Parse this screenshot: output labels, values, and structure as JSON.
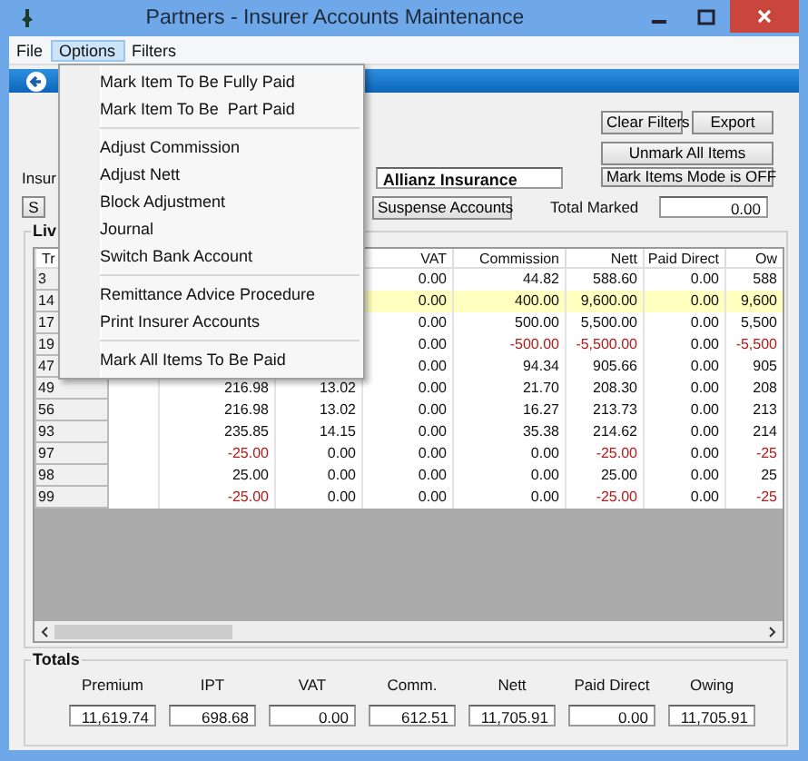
{
  "window": {
    "title": "Partners - Insurer Accounts Maintenance"
  },
  "menubar": [
    {
      "label": "File",
      "selected": false
    },
    {
      "label": "Options",
      "selected": true
    },
    {
      "label": "Filters",
      "selected": false
    }
  ],
  "options_menu": [
    [
      "Mark Item To Be Fully Paid",
      "Mark Item To Be  Part Paid"
    ],
    [
      "Adjust Commission",
      "Adjust Nett",
      "Block Adjustment",
      "Journal",
      "Switch Bank Account"
    ],
    [
      "Remittance Advice Procedure",
      "Print Insurer Accounts"
    ],
    [
      "Mark All Items To Be Paid"
    ]
  ],
  "form": {
    "clear_filters": "Clear Filters",
    "export": "Export",
    "unmark_all": "Unmark All Items",
    "mark_mode": "Mark Items Mode is OFF",
    "insurer_label": "Insur",
    "insurer_value": "Allianz Insurance",
    "s_button": "S",
    "suspense": "Suspense Accounts",
    "total_marked_label": "Total Marked",
    "total_marked_value": "0.00"
  },
  "table": {
    "group_label": "Liv",
    "columns": [
      "Tr",
      null,
      null,
      null,
      "VAT",
      "Commission",
      "Nett",
      "Paid Direct",
      "Ow"
    ],
    "rows": [
      {
        "selected": false,
        "cells": [
          "3",
          null,
          null,
          null,
          "0.00",
          "44.82",
          "588.60",
          "0.00",
          "588"
        ]
      },
      {
        "selected": true,
        "cells": [
          "14",
          null,
          null,
          null,
          "0.00",
          "400.00",
          "9,600.00",
          "0.00",
          "9,600"
        ]
      },
      {
        "selected": false,
        "cells": [
          "17",
          null,
          null,
          null,
          "0.00",
          "500.00",
          "5,500.00",
          "0.00",
          "5,500"
        ]
      },
      {
        "selected": false,
        "cells": [
          "19",
          null,
          null,
          null,
          "0.00",
          {
            "text": "-500.00",
            "negative": true
          },
          {
            "text": "-5,500.00",
            "negative": true
          },
          "0.00",
          {
            "text": "-5,500",
            "negative": true
          }
        ]
      },
      {
        "selected": false,
        "cells": [
          "47",
          null,
          null,
          null,
          "0.00",
          "94.34",
          "905.66",
          "0.00",
          "905"
        ]
      },
      {
        "selected": false,
        "cells": [
          "49",
          null,
          "216.98",
          "13.02",
          "0.00",
          "21.70",
          "208.30",
          "0.00",
          "208"
        ]
      },
      {
        "selected": false,
        "cells": [
          "56",
          null,
          "216.98",
          "13.02",
          "0.00",
          "16.27",
          "213.73",
          "0.00",
          "213"
        ]
      },
      {
        "selected": false,
        "cells": [
          "93",
          null,
          "235.85",
          "14.15",
          "0.00",
          "35.38",
          "214.62",
          "0.00",
          "214"
        ]
      },
      {
        "selected": false,
        "cells": [
          "97",
          null,
          {
            "text": "-25.00",
            "negative": true
          },
          "0.00",
          "0.00",
          "0.00",
          {
            "text": "-25.00",
            "negative": true
          },
          "0.00",
          {
            "text": "-25",
            "negative": true
          }
        ]
      },
      {
        "selected": false,
        "cells": [
          "98",
          null,
          "25.00",
          "0.00",
          "0.00",
          "0.00",
          "25.00",
          "0.00",
          "25"
        ]
      },
      {
        "selected": false,
        "cells": [
          "99",
          null,
          {
            "text": "-25.00",
            "negative": true
          },
          "0.00",
          "0.00",
          "0.00",
          {
            "text": "-25.00",
            "negative": true
          },
          "0.00",
          {
            "text": "-25",
            "negative": true
          }
        ]
      }
    ]
  },
  "totals": {
    "label": "Totals",
    "items": [
      {
        "label": "Premium",
        "value": "11,619.74"
      },
      {
        "label": "IPT",
        "value": "698.68"
      },
      {
        "label": "VAT",
        "value": "0.00"
      },
      {
        "label": "Comm.",
        "value": "612.51"
      },
      {
        "label": "Nett",
        "value": "11,705.91"
      },
      {
        "label": "Paid Direct",
        "value": "0.00"
      },
      {
        "label": "Owing",
        "value": "11,705.91"
      }
    ]
  }
}
